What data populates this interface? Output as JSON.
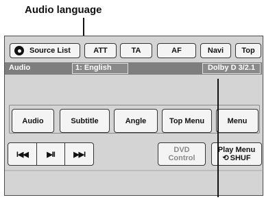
{
  "callouts": {
    "audio_language": "Audio language"
  },
  "top_bar": {
    "source_list": "Source List",
    "att": "ATT",
    "ta": "TA",
    "af": "AF",
    "navi": "Navi",
    "top": "Top"
  },
  "status": {
    "title": "Audio",
    "language": "1: English",
    "audio_format": "Dolby D 3/2.1"
  },
  "functions": {
    "audio": "Audio",
    "subtitle": "Subtitle",
    "angle": "Angle",
    "top_menu": "Top Menu",
    "menu": "Menu"
  },
  "transport": {
    "prev": "I◀◀",
    "play_pause": "▶II",
    "next": "▶▶I"
  },
  "dvd_control": {
    "line1": "DVD",
    "line2": "Control"
  },
  "play_menu": {
    "line1": "Play Menu",
    "shuffle_glyph": "⟲",
    "shuffle": "SHUF"
  },
  "icons": {
    "source": "source-icon",
    "shuffle": "shuffle-icon"
  }
}
